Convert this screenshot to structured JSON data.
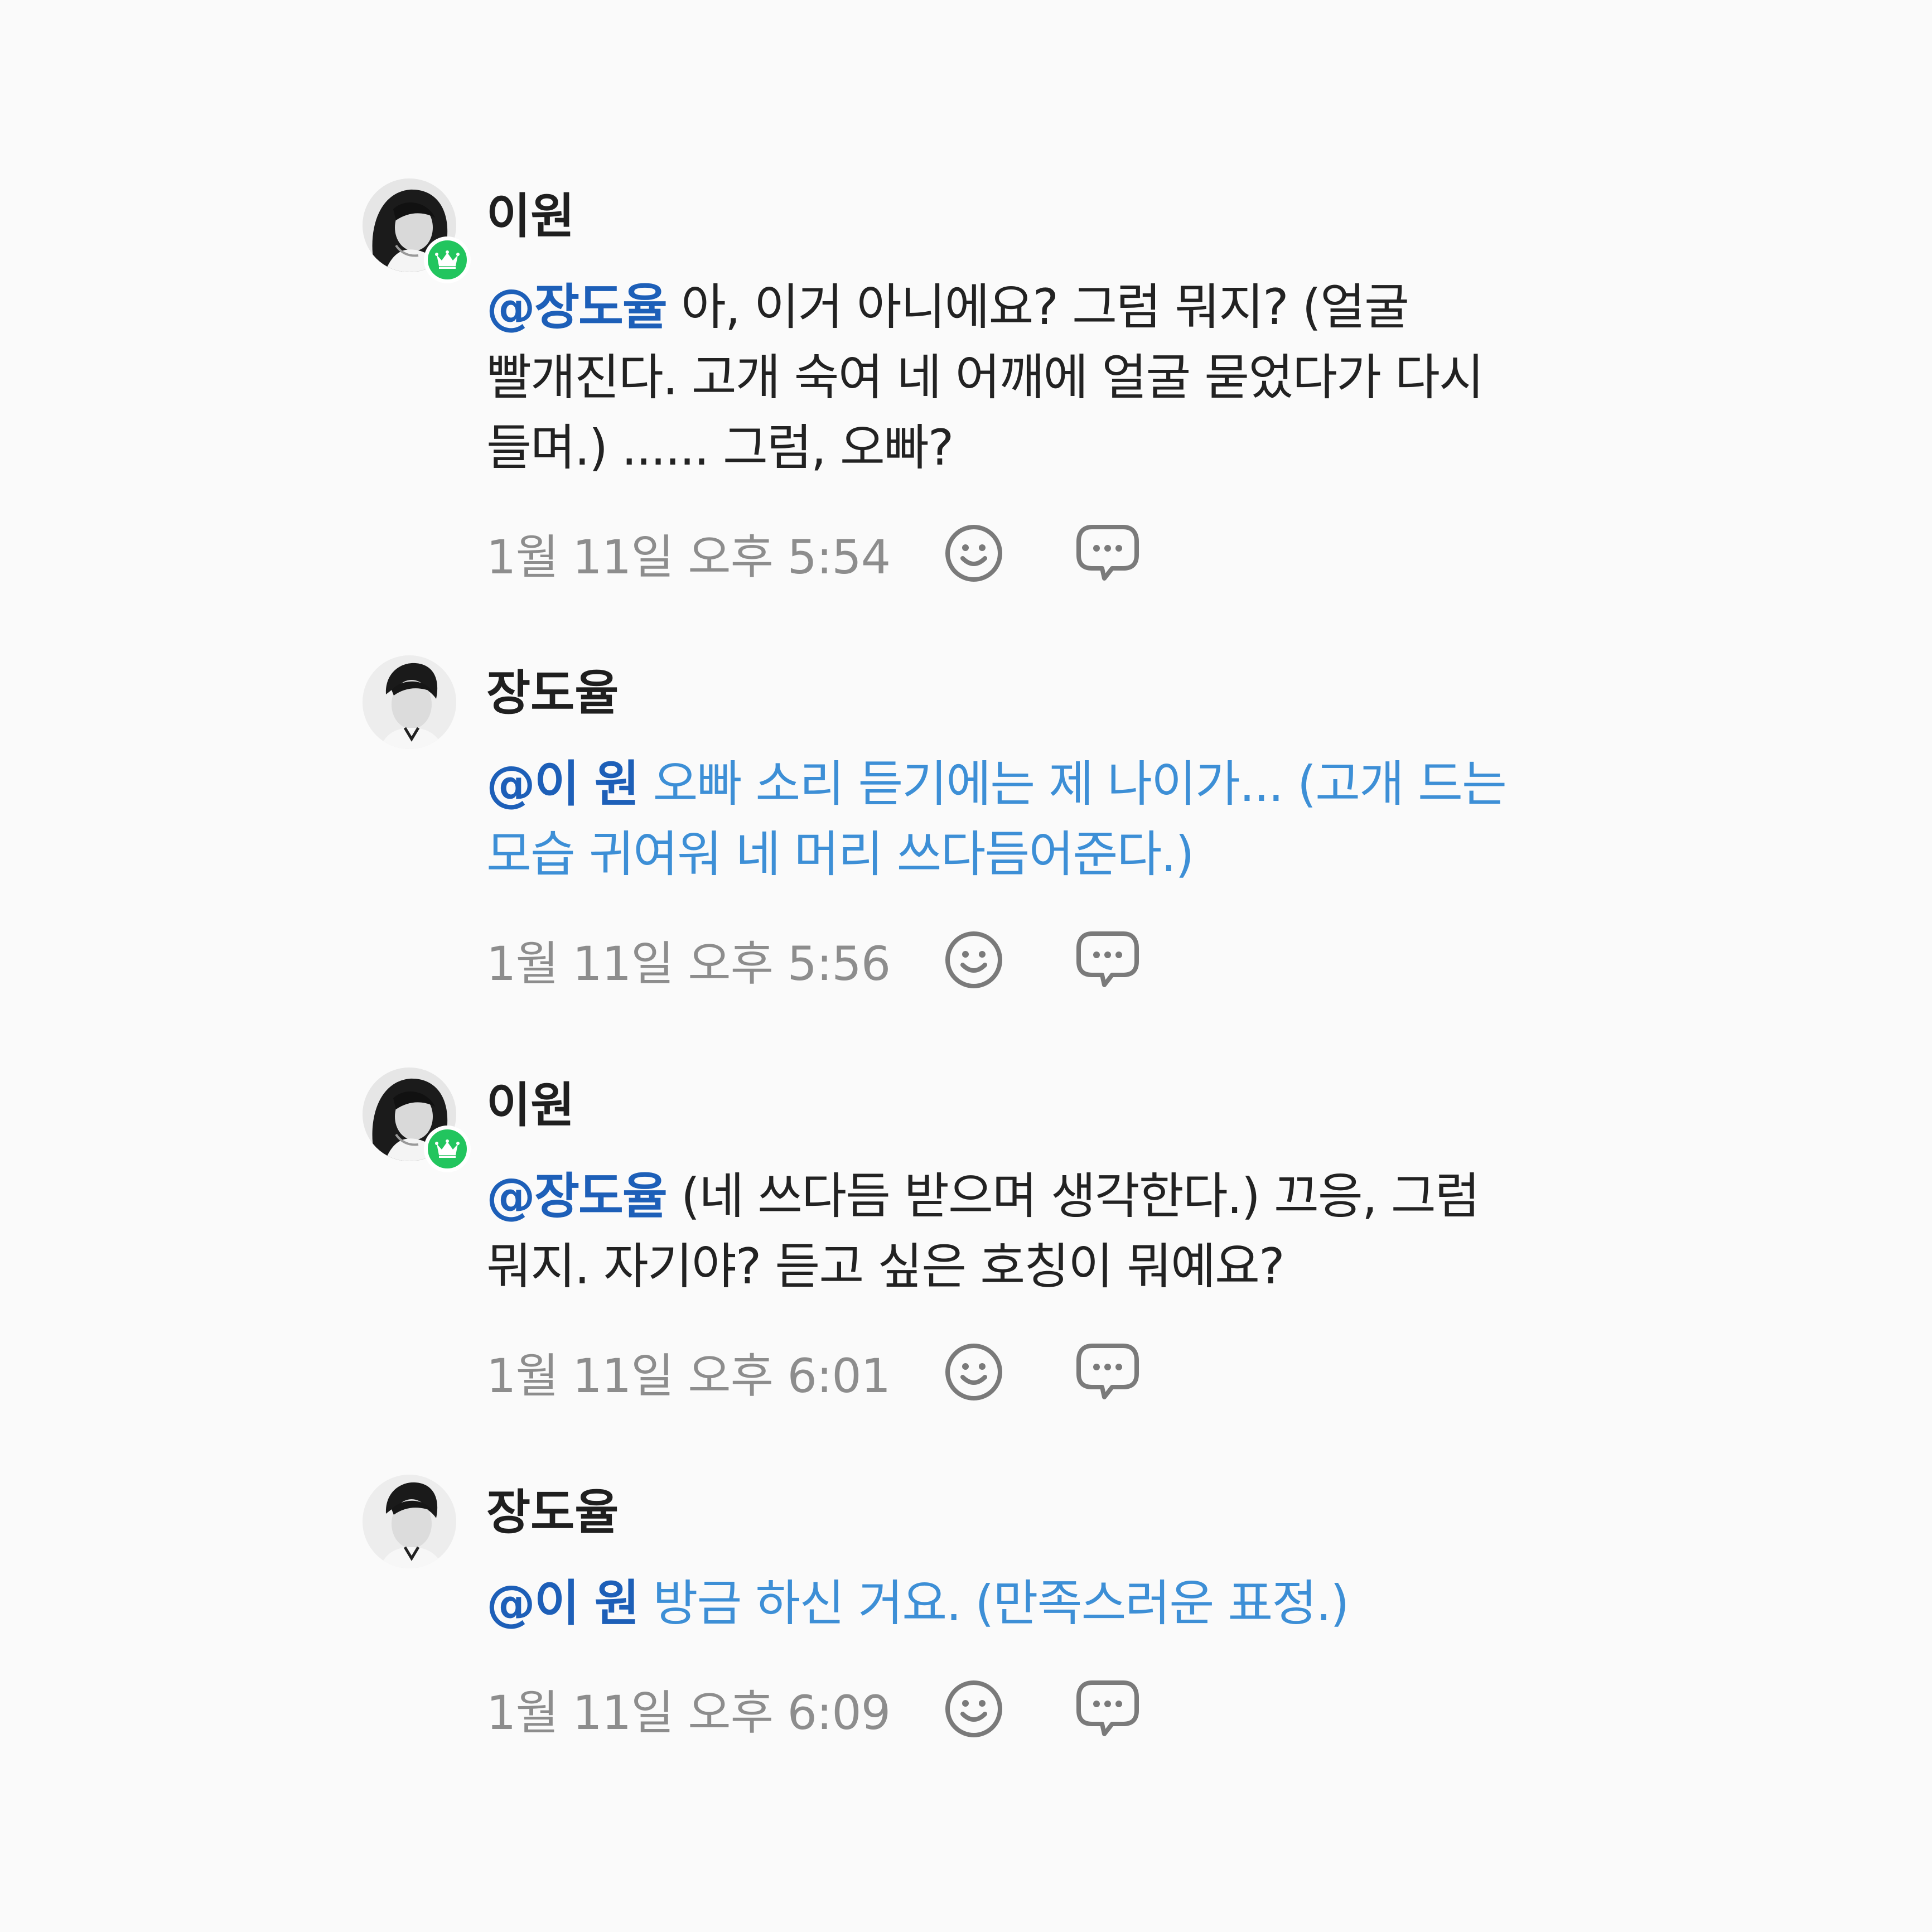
{
  "comments": [
    {
      "author": "이원",
      "avatar": "female-avatar",
      "badge": "crown-icon",
      "mention": "@장도율",
      "text": " 아, 이거 아니에요? 그럼 뭐지? (얼굴 빨개진다. 고개 숙여 네 어깨에 얼굴 묻었다가 다시 들며.) ...... 그럼, 오빠?",
      "text_color": "#222222",
      "timestamp": "1월 11일 오후 5:54"
    },
    {
      "author": "장도율",
      "avatar": "male-avatar",
      "mention": "@이 원",
      "text": " 오빠 소리 듣기에는 제 나이가... (고개 드는 모습 귀여워 네 머리 쓰다듬어준다.)",
      "text_color": "#3d8fd6",
      "timestamp": "1월 11일 오후 5:56"
    },
    {
      "author": "이원",
      "avatar": "female-avatar",
      "badge": "crown-icon",
      "mention": "@장도율",
      "text": " (네 쓰다듬 받으며 생각한다.) 끄응, 그럼 뭐지. 자기야? 듣고 싶은 호칭이 뭐예요?",
      "text_color": "#222222",
      "timestamp": "1월 11일 오후 6:01"
    },
    {
      "author": "장도율",
      "avatar": "male-avatar",
      "mention": "@이 원",
      "text": " 방금 하신 거요. (만족스러운 표정.)",
      "text_color": "#3d8fd6",
      "timestamp": "1월 11일 오후 6:09"
    }
  ],
  "colors": {
    "mention": "#1d5fb8",
    "reply_text": "#3d8fd6",
    "body_text": "#222222",
    "timestamp": "#8d8d8d",
    "badge": "#22c55e",
    "background": "#fafafa"
  },
  "icons": {
    "react": "smiley-icon",
    "reply": "speech-bubble-icon"
  }
}
